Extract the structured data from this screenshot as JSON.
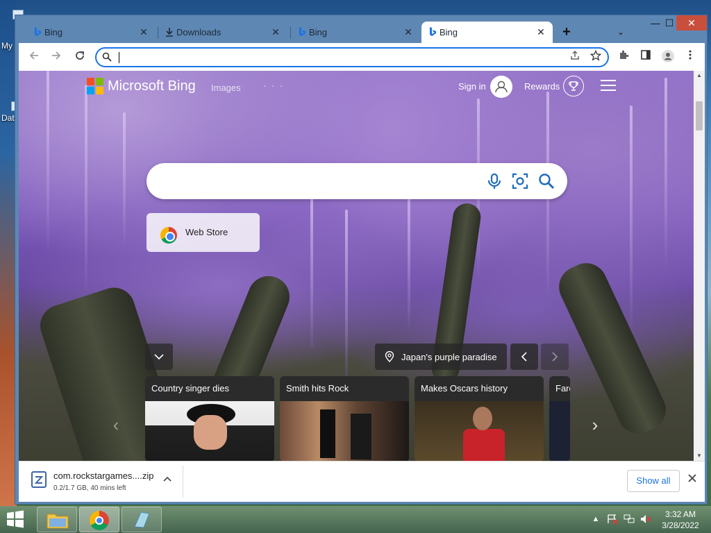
{
  "desktop": {
    "label_1": "My",
    "label_2": "Dat"
  },
  "browser": {
    "tabs": [
      {
        "label": "Bing",
        "icon": "bing-icon",
        "active": false
      },
      {
        "label": "Downloads",
        "icon": "download-icon",
        "active": false
      },
      {
        "label": "Bing",
        "icon": "bing-icon",
        "active": false
      },
      {
        "label": "Bing",
        "icon": "bing-icon",
        "active": true
      }
    ],
    "tab_close": "✕",
    "new_tab": "+",
    "tab_search": "⌄",
    "window_controls": {
      "minimize": "—",
      "maximize": "☐",
      "close": "✕"
    },
    "omnibox": {
      "value": "",
      "placeholder": ""
    }
  },
  "bing": {
    "brand": "Microsoft Bing",
    "images_link": "Images",
    "more_link": "· · ·",
    "sign_in": "Sign in",
    "rewards": "Rewards",
    "search": {
      "placeholder": ""
    },
    "tile_label": "Web Store",
    "image_location": "Japan's purple paradise",
    "news": [
      {
        "title": "Country singer dies"
      },
      {
        "title": "Smith hits Rock"
      },
      {
        "title": "Makes Oscars history"
      },
      {
        "title": "Fare"
      }
    ]
  },
  "downloads": {
    "filename": "com.rockstargames....zip",
    "status": "0.2/1.7 GB, 40 mins left",
    "show_all": "Show all"
  },
  "taskbar": {
    "time": "3:32 AM",
    "date": "3/28/2022"
  },
  "colors": {
    "accent": "#1a73e8",
    "titlebar": "#5e87b3",
    "ms_red": "#f25022",
    "ms_green": "#7fba00",
    "ms_blue": "#00a4ef",
    "ms_yellow": "#ffb900"
  }
}
